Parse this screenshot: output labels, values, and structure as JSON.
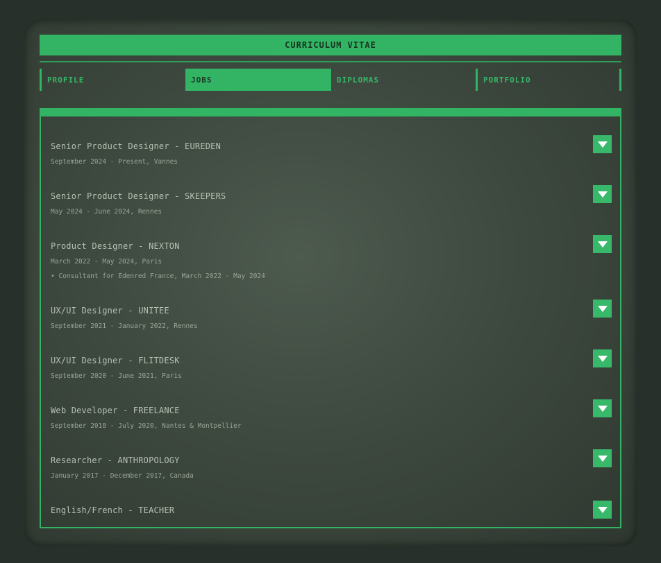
{
  "header": {
    "title": "CURRICULUM VITAE"
  },
  "tabs": [
    {
      "label": "PROFILE",
      "active": false
    },
    {
      "label": "JOBS",
      "active": true
    },
    {
      "label": "DIPLOMAS",
      "active": false
    },
    {
      "label": "PORTFOLIO",
      "active": false
    }
  ],
  "jobs": [
    {
      "title": "Senior Product Designer - EUREDEN",
      "meta": "September 2024 - Present, Vannes",
      "note": ""
    },
    {
      "title": "Senior Product Designer - SKEEPERS",
      "meta": "May 2024 - June 2024, Rennes",
      "note": ""
    },
    {
      "title": "Product Designer - NEXTON",
      "meta": "March 2022 - May 2024, Paris",
      "note": "• Consultant for Edenred France, March 2022 - May 2024"
    },
    {
      "title": "UX/UI Designer - UNITEE",
      "meta": "September 2021 - January 2022, Rennes",
      "note": ""
    },
    {
      "title": "UX/UI Designer - FLITDESK",
      "meta": "September 2020 - June 2021, Paris",
      "note": ""
    },
    {
      "title": "Web Developer - FREELANCE",
      "meta": "September 2018 - July 2020, Nantes & Montpellier",
      "note": ""
    },
    {
      "title": "Researcher - ANTHROPOLOGY",
      "meta": "January 2017 - December 2017, Canada",
      "note": ""
    },
    {
      "title": "English/French - TEACHER",
      "meta": "",
      "note": ""
    }
  ],
  "icons": {
    "expand": "chevron-down-icon"
  },
  "colors": {
    "accent": "#33b464",
    "screen": "#3c473d",
    "text": "#b7c0b3",
    "bezel": "#27302a"
  }
}
